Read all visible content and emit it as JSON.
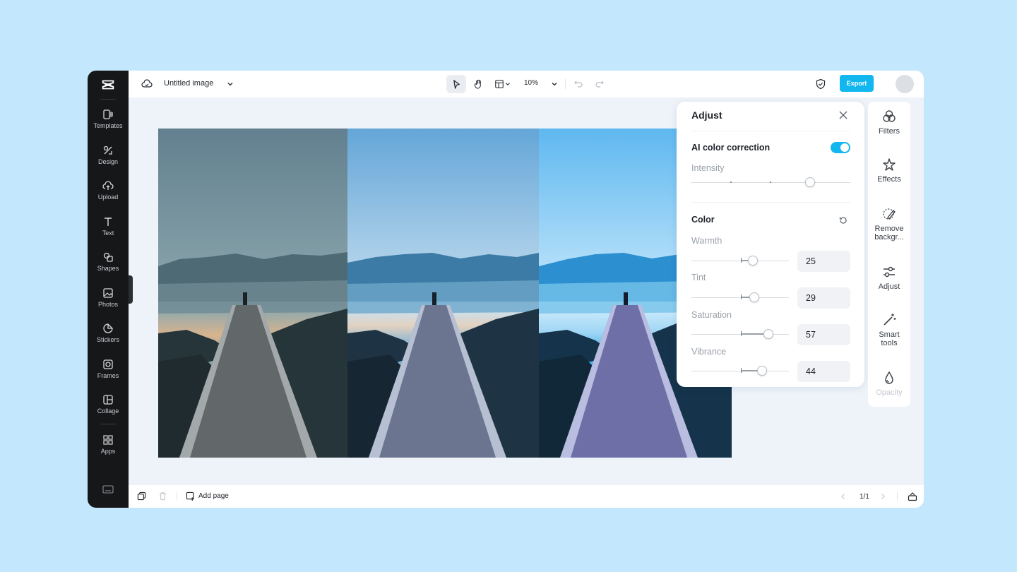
{
  "rail": {
    "items": [
      {
        "label": "Templates",
        "icon": "templates-icon"
      },
      {
        "label": "Design",
        "icon": "design-icon"
      },
      {
        "label": "Upload",
        "icon": "upload-icon"
      },
      {
        "label": "Text",
        "icon": "text-icon"
      },
      {
        "label": "Shapes",
        "icon": "shapes-icon"
      },
      {
        "label": "Photos",
        "icon": "photos-icon"
      },
      {
        "label": "Stickers",
        "icon": "stickers-icon"
      },
      {
        "label": "Frames",
        "icon": "frames-icon"
      },
      {
        "label": "Collage",
        "icon": "collage-icon"
      },
      {
        "label": "Apps",
        "icon": "apps-icon"
      }
    ]
  },
  "topbar": {
    "title": "Untitled image",
    "zoom": "10%",
    "export_label": "Export"
  },
  "canvas": {
    "images": [
      {
        "name": "original",
        "tint": "muted"
      },
      {
        "name": "adjusted-blue",
        "tint": "blue"
      },
      {
        "name": "adjusted-vivid",
        "tint": "vivid"
      }
    ]
  },
  "adjust": {
    "title": "Adjust",
    "ai_label": "AI color correction",
    "ai_enabled": true,
    "intensity_label": "Intensity",
    "intensity_value": 0.75,
    "color_label": "Color",
    "sliders": [
      {
        "label": "Warmth",
        "value": "25"
      },
      {
        "label": "Tint",
        "value": "29"
      },
      {
        "label": "Saturation",
        "value": "57"
      },
      {
        "label": "Vibrance",
        "value": "44"
      }
    ]
  },
  "tools": {
    "items": [
      {
        "label": "Filters",
        "icon": "filters-icon"
      },
      {
        "label": "Effects",
        "icon": "effects-icon"
      },
      {
        "label": "Remove backgr...",
        "icon": "remove-background-icon"
      },
      {
        "label": "Adjust",
        "icon": "adjust-icon"
      },
      {
        "label": "Smart tools",
        "icon": "smart-tools-icon"
      },
      {
        "label": "Opacity",
        "icon": "opacity-icon"
      }
    ]
  },
  "bottombar": {
    "add_page_label": "Add page",
    "page_indicator": "1/1"
  },
  "colors": {
    "accent": "#12b7ef",
    "rail_bg": "#151719",
    "page_bg": "#c3e8fd"
  }
}
